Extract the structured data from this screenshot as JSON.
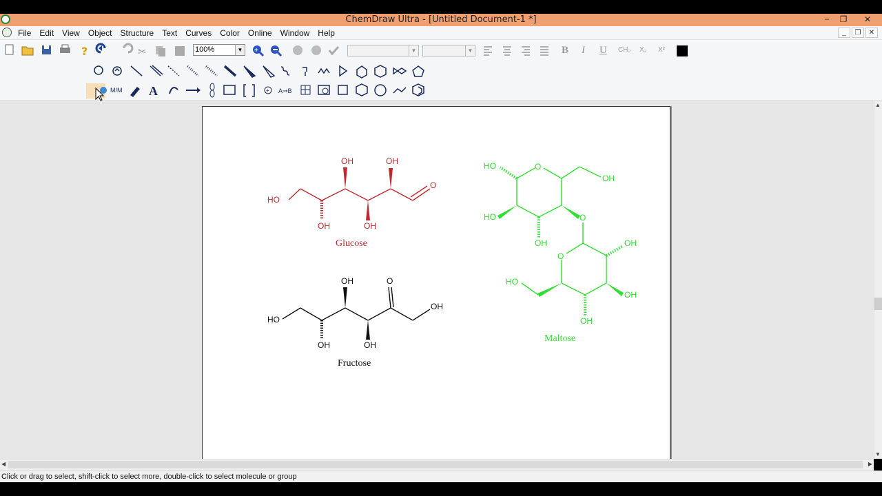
{
  "window": {
    "title": "ChemDraw Ultra - [Untitled Document-1 *]",
    "controls": [
      "−",
      "❐",
      "✕"
    ]
  },
  "menu": {
    "items": [
      "File",
      "Edit",
      "View",
      "Object",
      "Structure",
      "Text",
      "Curves",
      "Color",
      "Online",
      "Window",
      "Help"
    ]
  },
  "toolbar": {
    "zoom": "100%",
    "format_labels": {
      "bold": "B",
      "italic": "I",
      "underline": "U",
      "ch2": "CH₂",
      "sub": "X₂",
      "sup": "X²"
    }
  },
  "document": {
    "molecules": [
      {
        "name": "Glucose",
        "color": "#c0282d",
        "labels": {
          "ho_left": "HO",
          "oh_top1": "OH",
          "oh_top2": "OH",
          "oh_bot1": "OH",
          "oh_bot2": "OH",
          "o_aldehyde": "O"
        }
      },
      {
        "name": "Fructose",
        "color": "#111111",
        "labels": {
          "ho_left": "HO",
          "oh_top": "OH",
          "o_ketone": "O",
          "oh_right": "OH",
          "oh_bot1": "OH",
          "oh_bot2": "OH"
        }
      },
      {
        "name": "Maltose",
        "color": "#33dd33",
        "labels": {
          "ho1": "HO",
          "o_ring1": "O",
          "oh1": "OH",
          "ho2": "HO",
          "oh2": "OH",
          "o_link": "O",
          "oh3": "OH",
          "o_ring2": "O",
          "ho3": "HO",
          "oh4": "OH",
          "oh5": "OH"
        }
      }
    ]
  },
  "status": {
    "text": "Click or drag to select, shift-click to select more, double-click to select molecule or group"
  },
  "colors": {
    "titlebar": "#f0a070",
    "glucose": "#c0282d",
    "fructose": "#111111",
    "maltose": "#33dd33"
  }
}
